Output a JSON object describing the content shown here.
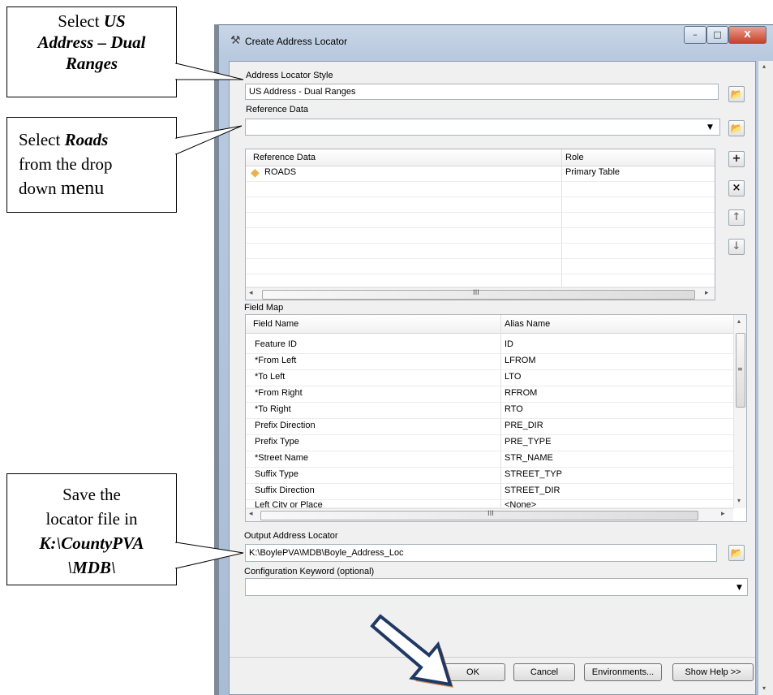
{
  "window": {
    "title": "Create Address Locator",
    "controls": {
      "minimize": "–",
      "maximize": "□",
      "close": "X"
    }
  },
  "callouts": {
    "style": {
      "plain1": "Select ",
      "bold1": "US",
      "bold2": "Address – Dual",
      "bold3": "Ranges"
    },
    "roads": {
      "plain1": "Select ",
      "bold1": "Roads",
      "plain2": "from the drop",
      "plain3": "down ",
      "big": "menu"
    },
    "save": {
      "plain1": "Save the",
      "plain2": "locator file in",
      "bold1": "K:\\CountyPVA",
      "bold2": "\\MDB\\"
    }
  },
  "form": {
    "style_label": "Address Locator Style",
    "style_value": "US Address - Dual Ranges",
    "refdata_label": "Reference Data",
    "refdata_value": "",
    "fieldmap_label": "Field Map",
    "output_label": "Output Address Locator",
    "output_value": "K:\\BoylePVA\\MDB\\Boyle_Address_Loc",
    "config_label": "Configuration Keyword (optional)",
    "config_value": ""
  },
  "ref_table": {
    "headers": [
      "Reference Data",
      "Role"
    ],
    "rows": [
      {
        "name": "ROADS",
        "role": "Primary Table"
      }
    ],
    "side_buttons": [
      "+",
      "×",
      "↑",
      "↓"
    ]
  },
  "field_map": {
    "headers": [
      "Field Name",
      "Alias Name"
    ],
    "rows": [
      {
        "field": "Feature ID",
        "alias": "ID"
      },
      {
        "field": "*From Left",
        "alias": "LFROM"
      },
      {
        "field": "*To Left",
        "alias": "LTO"
      },
      {
        "field": "*From Right",
        "alias": "RFROM"
      },
      {
        "field": "*To Right",
        "alias": "RTO"
      },
      {
        "field": "Prefix Direction",
        "alias": "PRE_DIR"
      },
      {
        "field": "Prefix Type",
        "alias": "PRE_TYPE"
      },
      {
        "field": "*Street Name",
        "alias": "STR_NAME"
      },
      {
        "field": "Suffix Type",
        "alias": "STREET_TYP"
      },
      {
        "field": "Suffix Direction",
        "alias": "STREET_DIR"
      },
      {
        "field": "Left City or Place",
        "alias": "<None>"
      }
    ]
  },
  "buttons": {
    "ok": "OK",
    "cancel": "Cancel",
    "environments": "Environments...",
    "show_help": "Show Help >>"
  },
  "scroll_glyphs": {
    "left": "◂",
    "right": "▸",
    "up": "▴",
    "down": "▾",
    "grip": "III",
    "vgrip": "≡",
    "dropdown": "▼"
  },
  "icons": {
    "tool": "hammer-icon",
    "browse": "folder-open-icon",
    "feature_class": "polyline-feature-icon",
    "pointer": "blue-arrow"
  },
  "colors": {
    "arrow_fill": "#ffffff",
    "arrow_stroke": "#1f3864",
    "arrow_shadow": "#c55a11",
    "feature_icon": "#e8b54a"
  }
}
